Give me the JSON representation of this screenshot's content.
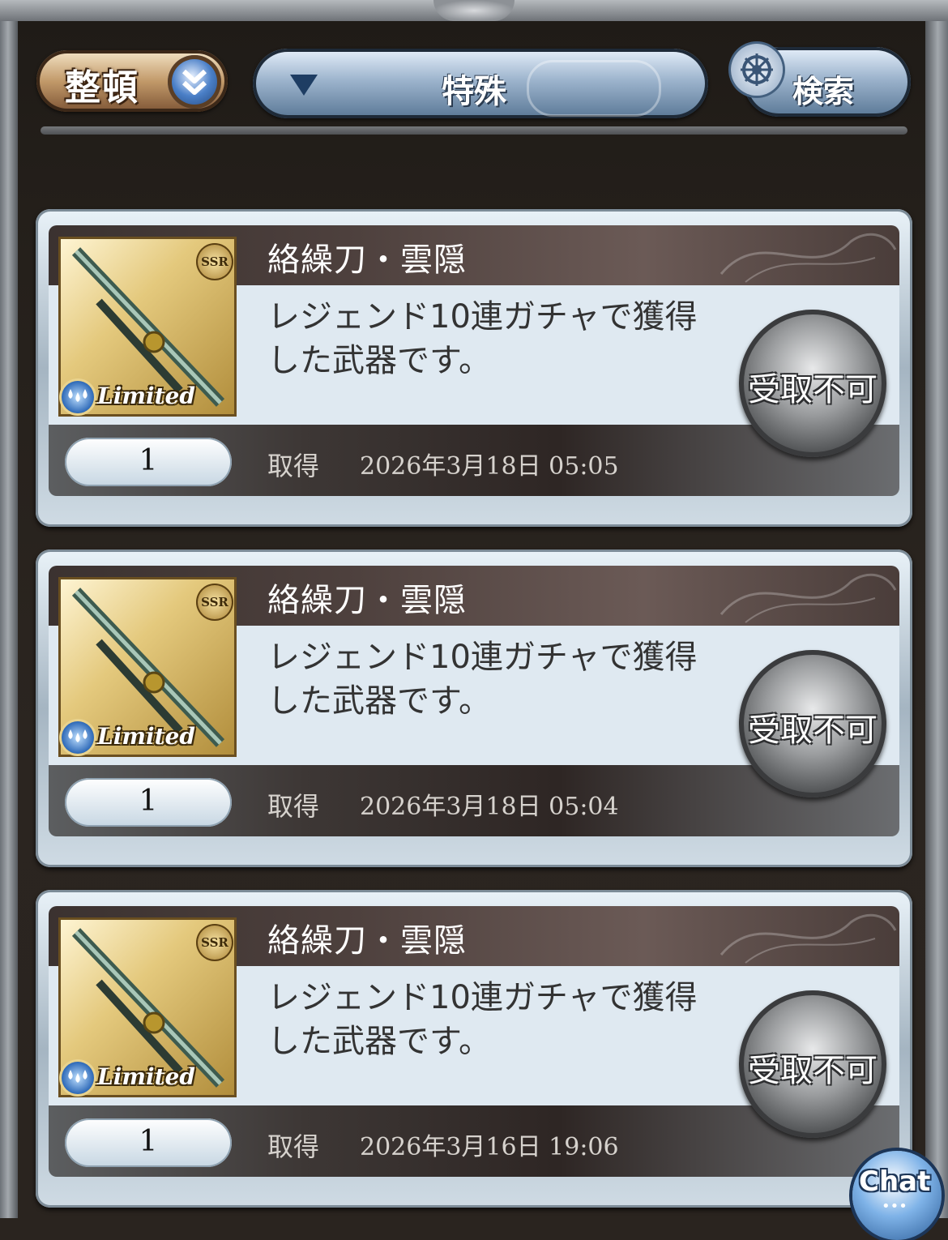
{
  "toolbar": {
    "sort_label": "整頓",
    "filter_label": "特殊",
    "search_label": "検索"
  },
  "items": [
    {
      "name": "絡繰刀・雲隠",
      "description": "レジェンド10連ガチャで獲得した武器です。",
      "rarity": "SSR",
      "tag": "Limited",
      "quantity": "1",
      "acquired_label": "取得",
      "acquired_date": "2026年3月18日 05:05",
      "action_label": "受取不可"
    },
    {
      "name": "絡繰刀・雲隠",
      "description": "レジェンド10連ガチャで獲得した武器です。",
      "rarity": "SSR",
      "tag": "Limited",
      "quantity": "1",
      "acquired_label": "取得",
      "acquired_date": "2026年3月18日 05:04",
      "action_label": "受取不可"
    },
    {
      "name": "絡繰刀・雲隠",
      "description": "レジェンド10連ガチャで獲得した武器です。",
      "rarity": "SSR",
      "tag": "Limited",
      "quantity": "1",
      "acquired_label": "取得",
      "acquired_date": "2026年3月16日 19:06",
      "action_label": "受取不可"
    }
  ],
  "chat": {
    "label": "Chat"
  },
  "colors": {
    "frame": "#24201c",
    "card_bg": "#dfe9f1",
    "title_bar": "#3b3230",
    "accent_blue": "#2c68b7",
    "gold": "#e4c97d"
  }
}
